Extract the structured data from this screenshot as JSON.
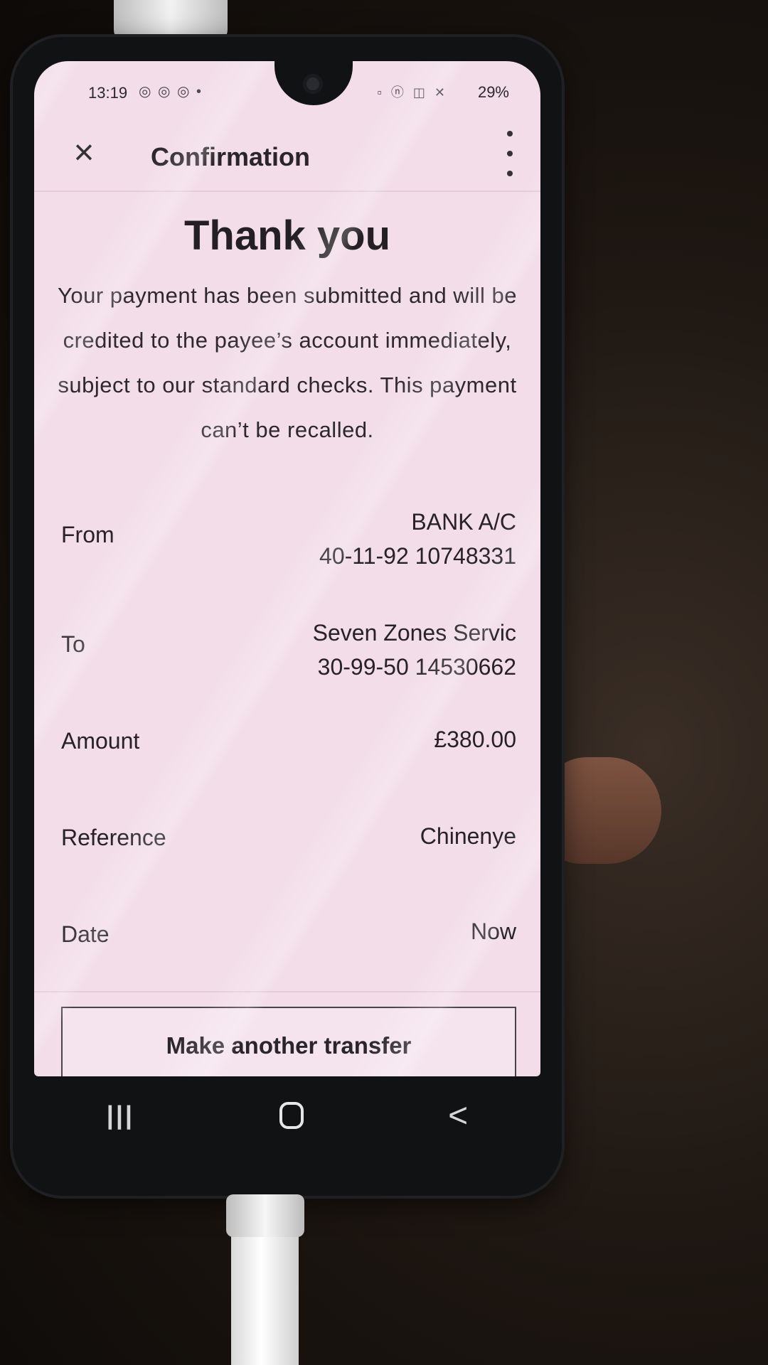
{
  "status_bar": {
    "time": "13:19",
    "notification_icons": "◎ ◎ ◎ •",
    "system_icons": "▫ ⓝ ◫ ✕",
    "battery": "29%"
  },
  "header": {
    "title": "Confirmation"
  },
  "thanks_title": "Thank you",
  "message": "Your payment has been submitted and will be credited to the payee’s account immediately, subject to our standard checks. This payment can’t be recalled.",
  "details": {
    "from": {
      "label": "From",
      "line1": "BANK A/C",
      "line2": "40-11-92 10748331"
    },
    "to": {
      "label": "To",
      "line1": "Seven Zones Servic",
      "line2": "30-99-50 14530662"
    },
    "amount": {
      "label": "Amount",
      "value": "£380.00"
    },
    "reference": {
      "label": "Reference",
      "value": "Chinenye"
    },
    "date": {
      "label": "Date",
      "value": "Now"
    }
  },
  "cta": {
    "label": "Make another transfer"
  },
  "navbar": {
    "recents": "|||",
    "back": "<"
  },
  "colors": {
    "screen_bg": "#f2dde8",
    "text": "#262225",
    "phone_frame": "#111214"
  }
}
